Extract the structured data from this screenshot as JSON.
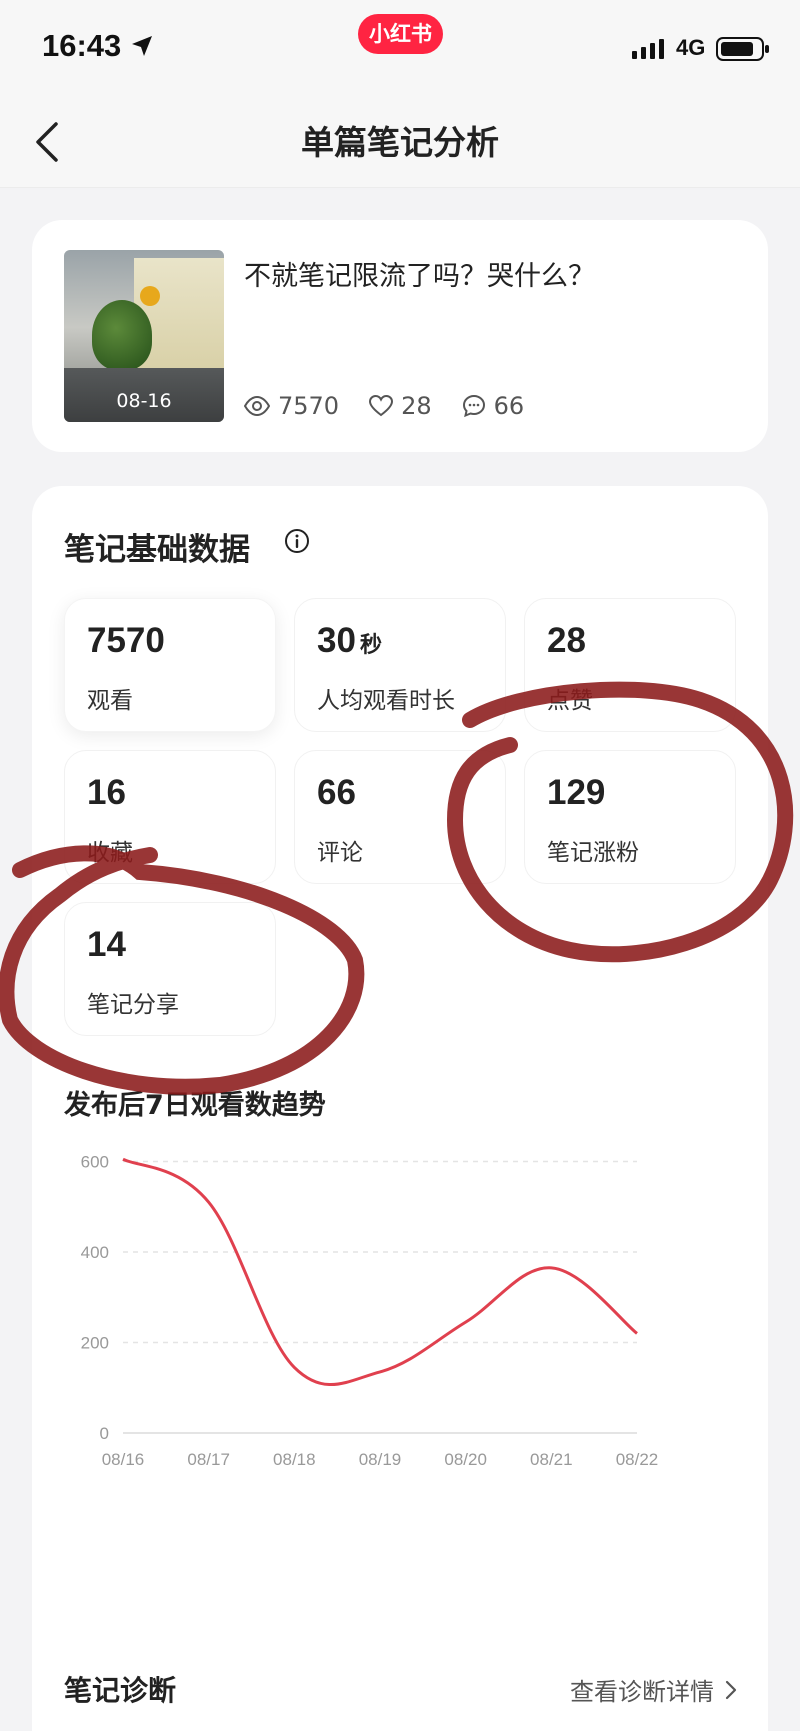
{
  "status_bar": {
    "time": "16:43",
    "app_badge": "小红书",
    "network": "4G"
  },
  "header": {
    "title": "单篇笔记分析"
  },
  "note": {
    "title": "不就笔记限流了吗？哭什么？",
    "thumbnail_date": "08-16",
    "views": "7570",
    "likes": "28",
    "comments": "66"
  },
  "basic_data": {
    "title": "笔记基础数据",
    "metrics": [
      {
        "value": "7570",
        "unit": "",
        "label": "观看"
      },
      {
        "value": "30",
        "unit": "秒",
        "label": "人均观看时长"
      },
      {
        "value": "28",
        "unit": "",
        "label": "点赞"
      },
      {
        "value": "16",
        "unit": "",
        "label": "收藏"
      },
      {
        "value": "66",
        "unit": "",
        "label": "评论"
      },
      {
        "value": "129",
        "unit": "",
        "label": "笔记涨粉"
      },
      {
        "value": "14",
        "unit": "",
        "label": "笔记分享"
      }
    ]
  },
  "chart_title": "发布后7日观看数趋势",
  "chart_data": {
    "type": "line",
    "title": "发布后7日观看数趋势",
    "xlabel": "",
    "ylabel": "",
    "categories": [
      "08/16",
      "08/17",
      "08/18",
      "08/19",
      "08/20",
      "08/21",
      "08/22"
    ],
    "values": [
      605,
      510,
      145,
      135,
      245,
      365,
      220
    ],
    "ylim": [
      0,
      800
    ],
    "yticks": [
      "0",
      "200",
      "400",
      "600",
      "800"
    ],
    "grid": true,
    "line_color": "#e0404e"
  },
  "diagnosis": {
    "title": "笔记诊断",
    "link": "查看诊断详情"
  },
  "colors": {
    "brand": "#ff2442",
    "annotation": "#8b1a1a"
  }
}
